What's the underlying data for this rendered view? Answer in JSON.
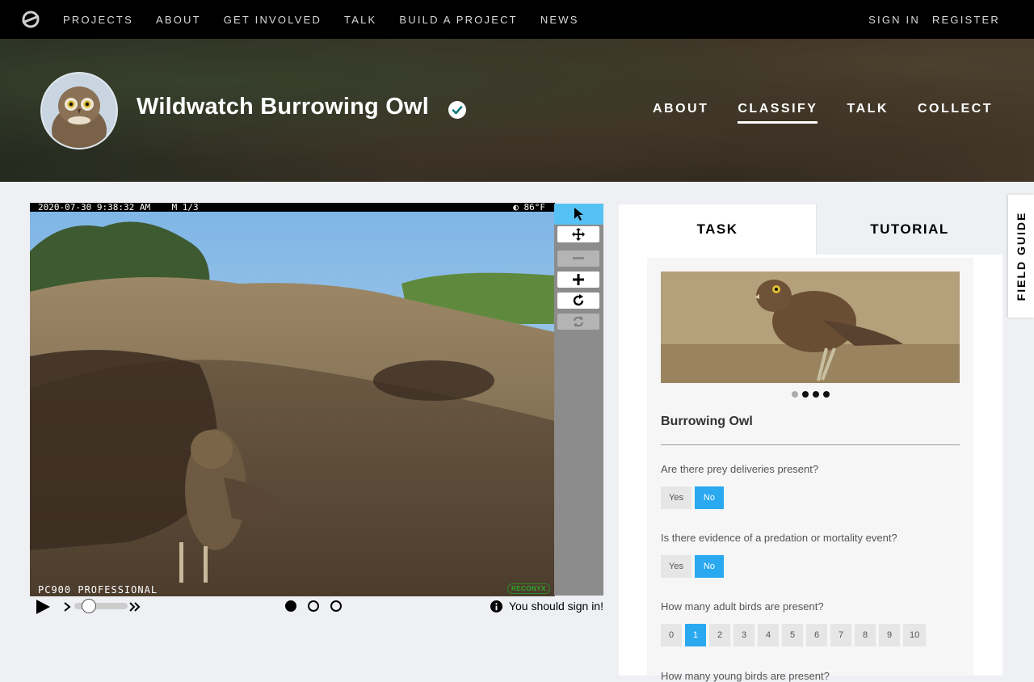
{
  "topnav": {
    "links": [
      "PROJECTS",
      "ABOUT",
      "GET INVOLVED",
      "TALK",
      "BUILD A PROJECT",
      "NEWS"
    ],
    "sign_in": "SIGN IN",
    "register": "REGISTER"
  },
  "project": {
    "title": "Wildwatch Burrowing Owl",
    "nav": [
      "ABOUT",
      "CLASSIFY",
      "TALK",
      "COLLECT"
    ],
    "active_nav": "CLASSIFY"
  },
  "subject": {
    "camera_header_left": "2020-07-30 9:38:32 AM    M 1/3",
    "camera_header_right": "◐  86°F",
    "camera_footer": "PC900 PROFESSIONAL",
    "camera_brand": "RECONYX",
    "frames": 3,
    "current_frame": 1,
    "playback_position": 0.3
  },
  "viewer": {
    "sign_in_message": "You should sign in!"
  },
  "task_panel": {
    "tabs": {
      "task": "TASK",
      "tutorial": "TUTORIAL"
    },
    "species": "Burrowing Owl",
    "carousel_count": 4,
    "carousel_active": 1,
    "questions": [
      {
        "text": "Are there prey deliveries present?",
        "options": [
          "Yes",
          "No"
        ],
        "selected": "No"
      },
      {
        "text": "Is there evidence of a predation or mortality event?",
        "options": [
          "Yes",
          "No"
        ],
        "selected": "No"
      },
      {
        "text": "How many adult birds are present?",
        "options": [
          "0",
          "1",
          "2",
          "3",
          "4",
          "5",
          "6",
          "7",
          "8",
          "9",
          "10"
        ],
        "selected": "1"
      },
      {
        "text": "How many young birds are present?"
      }
    ]
  },
  "field_guide": {
    "label": "FIELD GUIDE"
  },
  "colors": {
    "accent": "#2aa8f0",
    "toolbar_active": "#56c1f5",
    "verified": "#0b7a7a"
  },
  "icons": [
    "zooniverse-logo-icon",
    "verified-check-icon",
    "pointer-icon",
    "move-icon",
    "zoom-out-icon",
    "zoom-in-icon",
    "rotate-icon",
    "reset-icon",
    "play-icon",
    "info-icon"
  ]
}
